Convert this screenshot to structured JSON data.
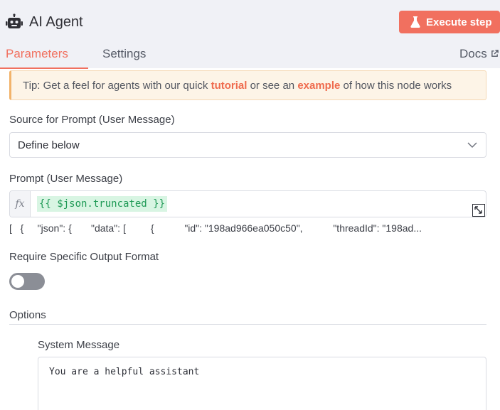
{
  "header": {
    "title": "AI Agent",
    "execute_label": "Execute step",
    "accent_color": "#f1705f"
  },
  "tabs": {
    "parameters": "Parameters",
    "settings": "Settings",
    "docs": "Docs"
  },
  "tip": {
    "prefix": "Tip: Get a feel for agents with our quick ",
    "link1": "tutorial",
    "middle": " or see an ",
    "link2": "example",
    "suffix": " of how this node works"
  },
  "source": {
    "label": "Source for Prompt (User Message)",
    "value": "Define below"
  },
  "prompt": {
    "label": "Prompt (User Message)",
    "fx": "fx",
    "expression": "{{ $json.truncated }}",
    "preview": "[   {     \"json\": {       \"data\": [         {           \"id\": \"198ad966ea050c50\",           \"threadId\": \"198ad..."
  },
  "output_format": {
    "label": "Require Specific Output Format",
    "enabled": false
  },
  "options": {
    "label": "Options",
    "system_message_label": "System Message",
    "system_message_value": "You are a helpful assistant"
  }
}
